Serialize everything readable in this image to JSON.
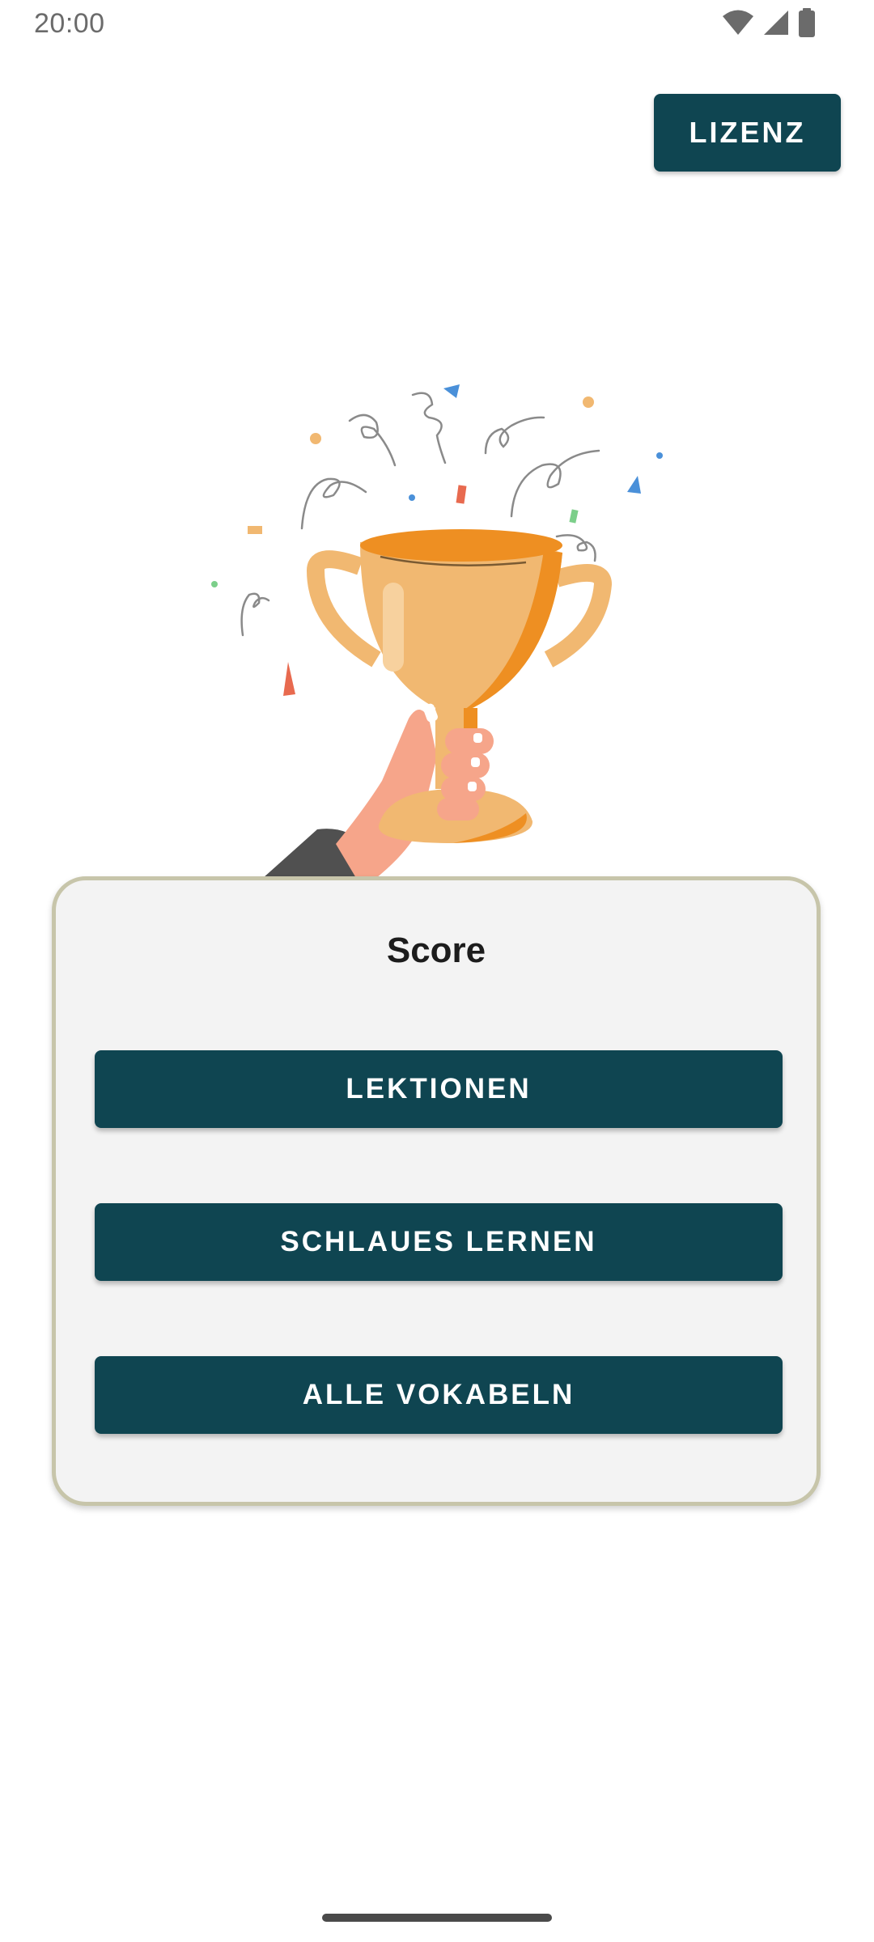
{
  "status_bar": {
    "time": "20:00",
    "icons": [
      "wifi-icon",
      "signal-icon",
      "battery-icon"
    ]
  },
  "header": {
    "license_button_label": "LIZENZ"
  },
  "illustration": {
    "name": "trophy-in-hand-with-confetti"
  },
  "card": {
    "title": "Score",
    "buttons": [
      {
        "label": "LEKTIONEN"
      },
      {
        "label": "SCHLAUES LERNEN"
      },
      {
        "label": "ALLE VOKABELN"
      }
    ]
  },
  "colors": {
    "primary_button": "#0f4551",
    "card_background": "#f3f3f3",
    "card_border": "#c7c5aa",
    "trophy_gold": "#f1b871",
    "trophy_orange": "#ee8f22"
  }
}
